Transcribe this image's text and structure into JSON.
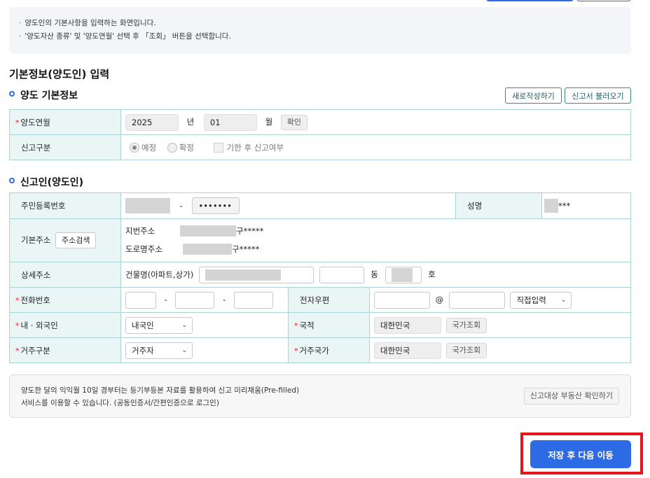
{
  "info": {
    "lines": [
      "양도인의 기본사항을 입력하는 화면입니다.",
      "'양도자산 종류' 및 '양도연월' 선택 후 「조회」 버튼을 선택합니다."
    ]
  },
  "heading": "기본정보(양도인) 입력",
  "section1": {
    "title": "양도 기본정보",
    "new_button": "새로작성하기",
    "load_button": "신고서 불러오기",
    "rows": {
      "month_label": "양도연월",
      "year_value": "2025",
      "year_unit": "년",
      "month_value": "01",
      "month_unit": "월",
      "confirm": "확인",
      "type_label": "신고구분",
      "radio_expected": "예정",
      "radio_final": "확정",
      "late_check": "기한 후 신고여부"
    }
  },
  "section2": {
    "title": "신고인(양도인)",
    "rrn_label": "주민등록번호",
    "rrn_dash": "-",
    "rrn_masked": "•••••••",
    "name_label": "성명",
    "name_masked": "***",
    "addr_label": "기본주소",
    "addr_search": "주소검색",
    "jibun_label": "지번주소",
    "jibun_suffix": "구*****",
    "road_label": "도로명주소",
    "road_suffix": "구*****",
    "detail_label": "상세주소",
    "building_label": "건물명(아파트,상가)",
    "dong_unit": "동",
    "ho_unit": "호",
    "phone_label": "전화번호",
    "phone_dash": "-",
    "email_label": "전자우편",
    "email_at": "@",
    "email_select": "직접입력",
    "nat_label": "내 · 외국인",
    "nat_value": "내국인",
    "country_label": "국적",
    "country_value": "대한민국",
    "country_btn": "국가조회",
    "res_label": "거주구분",
    "res_value": "거주자",
    "res_country_label": "거주국가",
    "res_country_value": "대한민국",
    "res_country_btn": "국가조회"
  },
  "notice": {
    "line1": "양도한 달의 익익월 10일 경부터는 등기부등본 자료를 활용하여 신고 미리채움(Pre-filled)",
    "line2": "서비스를 이용할 수 있습니다. (공동인증서/간편인증으로 로그인)",
    "button": "신고대상 부동산 확인하기"
  },
  "primary_button": "저장 후 다음 이동",
  "colors": {
    "accent": "#2d6be4",
    "teal_border": "#2f8a8c",
    "label_bg": "#eaf6f6",
    "highlight": "#e5161b"
  }
}
